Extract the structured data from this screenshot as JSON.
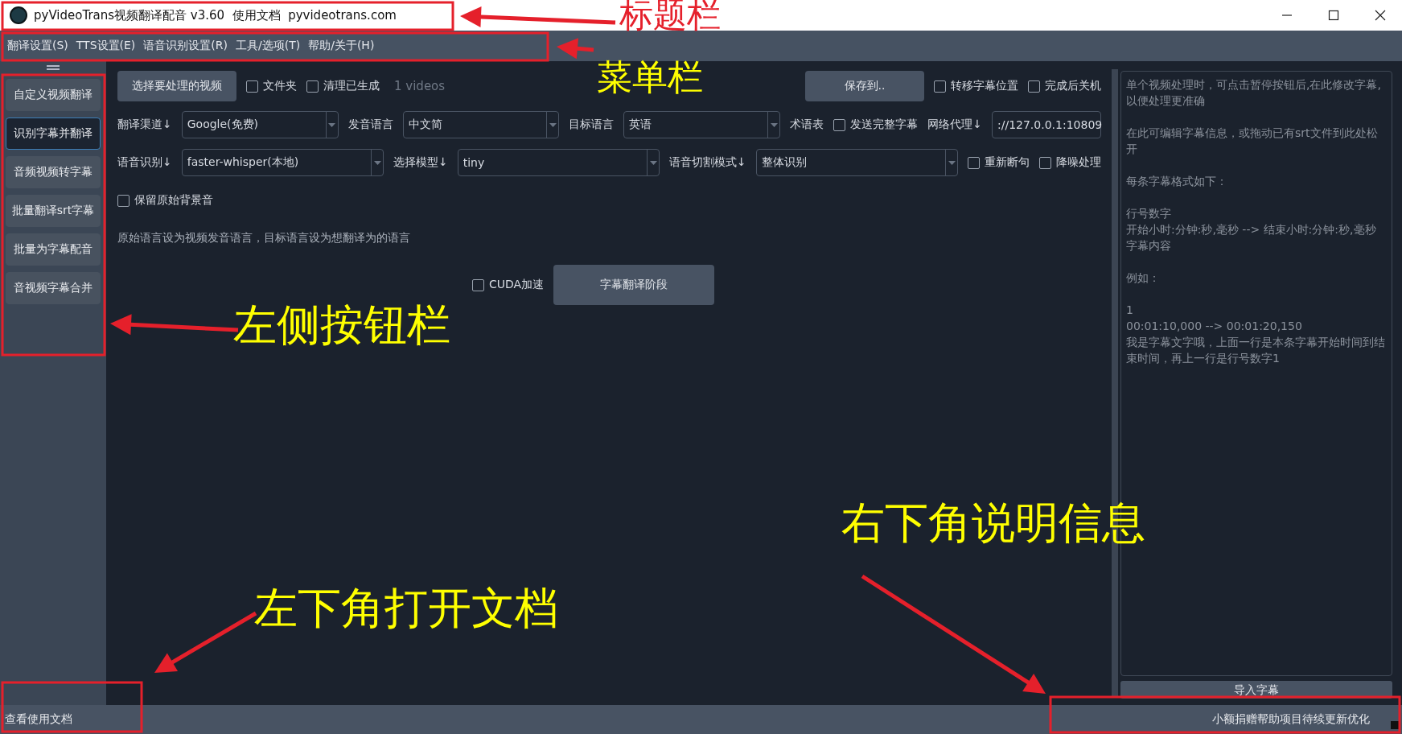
{
  "window": {
    "title": "pyVideoTrans视频翻译配音 v3.60  使用文档  pyvideotrans.com"
  },
  "menu": [
    {
      "label": "翻译设置(S)"
    },
    {
      "label": "TTS设置(E)"
    },
    {
      "label": "语音识别设置(R)"
    },
    {
      "label": "工具/选项(T)"
    },
    {
      "label": "帮助/关于(H)"
    }
  ],
  "sidebar": {
    "items": [
      {
        "label": "自定义视频翻译",
        "selected": false
      },
      {
        "label": "识别字幕并翻译",
        "selected": true
      },
      {
        "label": "音频视频转字幕",
        "selected": false
      },
      {
        "label": "批量翻译srt字幕",
        "selected": false
      },
      {
        "label": "批量为字幕配音",
        "selected": false
      },
      {
        "label": "音视频字幕合并",
        "selected": false
      }
    ]
  },
  "main": {
    "rows": [
      {
        "left": [
          {
            "kind": "button",
            "label": "选择要处理的视频"
          },
          {
            "kind": "checkbox",
            "label": "文件夹",
            "checked": false
          },
          {
            "kind": "checkbox",
            "label": "清理已生成",
            "checked": false
          },
          {
            "kind": "note",
            "text": "1 videos"
          }
        ],
        "right": [
          {
            "kind": "button",
            "label": "保存到.."
          },
          {
            "kind": "checkbox",
            "label": "转移字幕位置",
            "checked": false
          },
          {
            "kind": "checkbox",
            "label": "完成后关机",
            "checked": false
          }
        ]
      },
      {
        "left": [
          {
            "kind": "label",
            "text": "翻译渠道↓"
          },
          {
            "kind": "combo",
            "value": "Google(免费)"
          },
          {
            "kind": "label",
            "text": "发音语言"
          },
          {
            "kind": "combo",
            "value": "中文简"
          },
          {
            "kind": "label",
            "text": "目标语言"
          },
          {
            "kind": "combo",
            "value": "英语"
          },
          {
            "kind": "label",
            "text": "术语表"
          },
          {
            "kind": "checkbox",
            "label": "发送完整字幕",
            "checked": false
          },
          {
            "kind": "label",
            "text": "网络代理↓"
          },
          {
            "kind": "field",
            "value": "://127.0.0.1:10809"
          }
        ]
      },
      {
        "left": [
          {
            "kind": "label",
            "text": "语音识别↓"
          },
          {
            "kind": "combo",
            "value": "faster-whisper(本地)"
          },
          {
            "kind": "label",
            "text": "选择模型↓"
          },
          {
            "kind": "combo",
            "value": "tiny"
          },
          {
            "kind": "label",
            "text": "语音切割模式↓"
          },
          {
            "kind": "combo",
            "value": "整体识别"
          },
          {
            "kind": "checkbox",
            "label": "重新断句",
            "checked": false
          },
          {
            "kind": "checkbox",
            "label": "降噪处理",
            "checked": false
          }
        ]
      },
      {
        "left": [
          {
            "kind": "checkbox",
            "label": "保留原始背景音",
            "checked": false
          }
        ]
      },
      {
        "left": [
          {
            "kind": "text",
            "text": "原始语言设为视频发音语言，目标语言设为想翻译为的语言"
          }
        ]
      },
      {
        "center": [
          {
            "kind": "checkbox",
            "label": "CUDA加速",
            "checked": false
          },
          {
            "kind": "big-button",
            "label": "字幕翻译阶段"
          }
        ]
      }
    ]
  },
  "subtitle_editor": {
    "placeholder": [
      [
        "单个视频处理时，可点击暂停按钮后,在此修改字幕,以便处理更准确"
      ],
      [
        "在此可编辑字幕信息，或拖动已有srt文件到此处松开"
      ],
      [
        "每条字幕格式如下："
      ],
      [
        "行号数字",
        "开始小时:分钟:秒,毫秒 --> 结束小时:分钟:秒,毫秒",
        "字幕内容"
      ],
      [
        "例如："
      ],
      [
        "1",
        "00:01:10,000 --> 00:01:20,150",
        "我是字幕文字哦，上面一行是本条字幕开始时间到结束时间，再上一行是行号数字1"
      ]
    ]
  },
  "import_button": {
    "label": "导入字幕"
  },
  "status_bar": {
    "left": "查看使用文档",
    "right": "小额捐赠帮助项目待续更新优化"
  },
  "annotations": [
    {
      "text": "标题栏",
      "color": "#e5202b"
    },
    {
      "text": "菜单栏",
      "color": "#ffff00"
    },
    {
      "text": "左侧按钮栏",
      "color": "#ffff00"
    },
    {
      "text": "右下角说明信息",
      "color": "#ffff00"
    },
    {
      "text": "左下角打开文档",
      "color": "#ffff00"
    }
  ]
}
